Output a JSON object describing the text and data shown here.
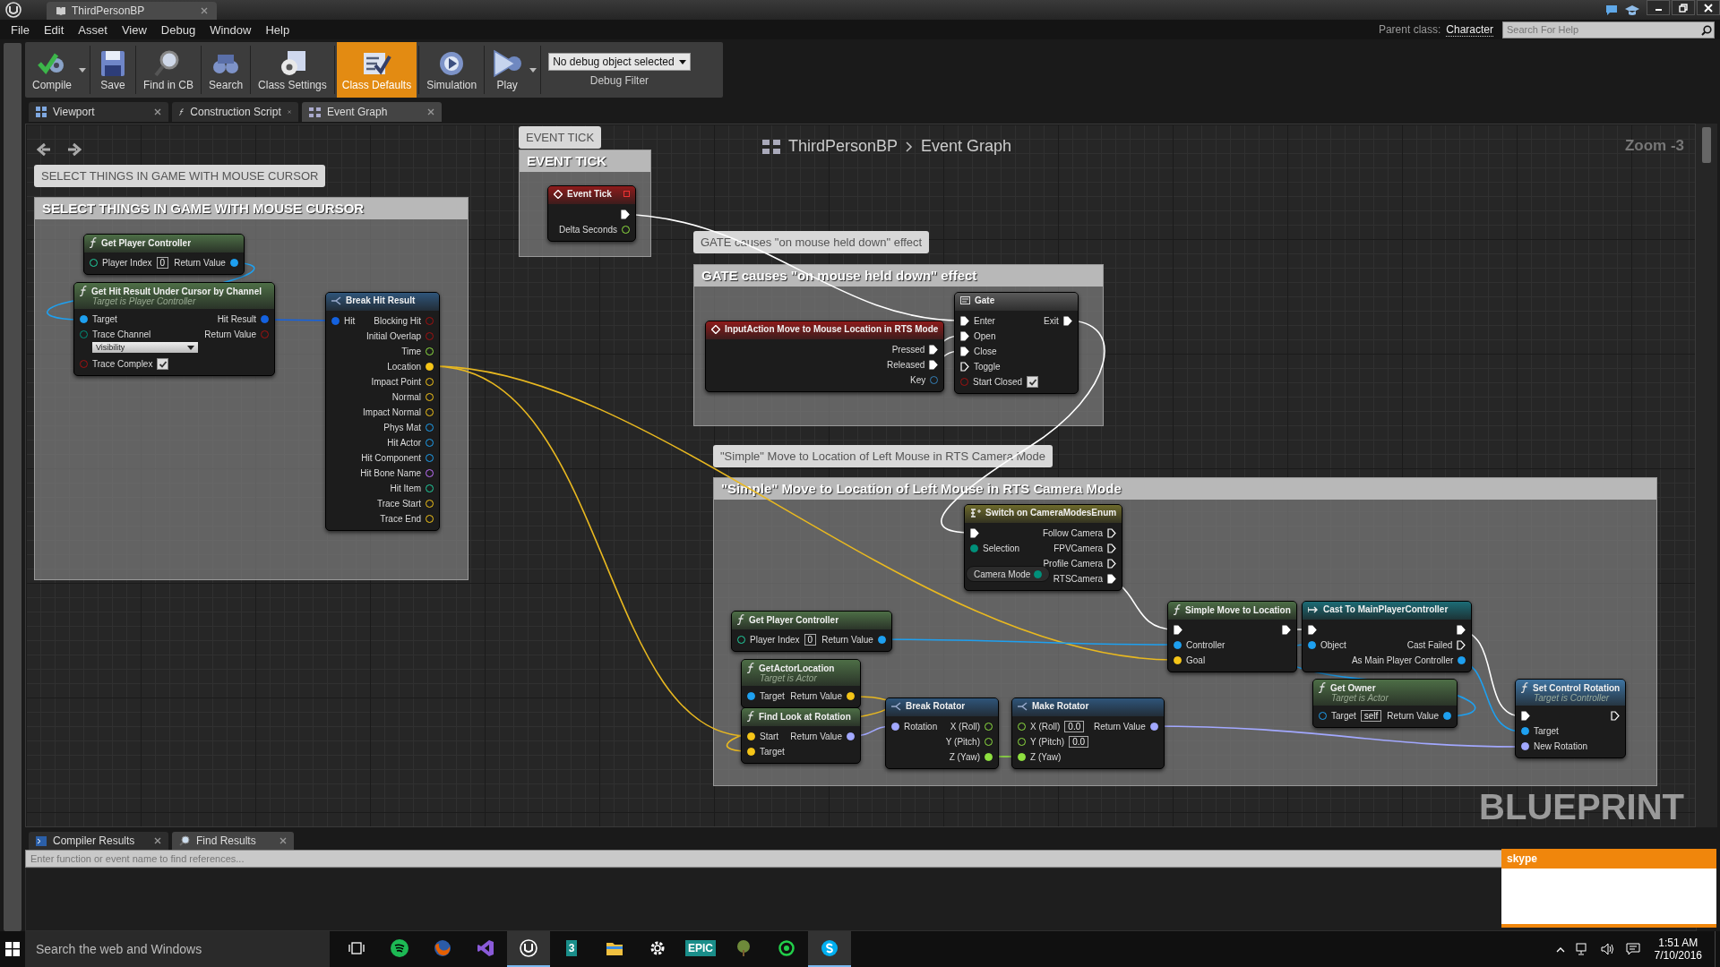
{
  "document_tab": {
    "title": "ThirdPersonBP"
  },
  "menu": [
    "File",
    "Edit",
    "Asset",
    "View",
    "Debug",
    "Window",
    "Help"
  ],
  "parent_class": {
    "label": "Parent class:",
    "value": "Character"
  },
  "help_search": {
    "placeholder": "Search For Help"
  },
  "toolbar": [
    {
      "label": "Compile",
      "kind": "compile",
      "selected": false,
      "has_menu": true
    },
    {
      "label": "Save",
      "kind": "save",
      "selected": false,
      "has_menu": false
    },
    {
      "label": "Find in CB",
      "kind": "find",
      "selected": false,
      "has_menu": false
    },
    {
      "label": "Search",
      "kind": "search",
      "selected": false,
      "has_menu": false
    },
    {
      "label": "Class Settings",
      "kind": "settings",
      "selected": false,
      "has_menu": false
    },
    {
      "label": "Class Defaults",
      "kind": "defaults",
      "selected": true,
      "has_menu": false
    },
    {
      "label": "Simulation",
      "kind": "simulation",
      "selected": false,
      "has_menu": false
    },
    {
      "label": "Play",
      "kind": "play",
      "selected": false,
      "has_menu": true
    }
  ],
  "debug_filter": {
    "value": "No debug object selected",
    "label": "Debug Filter"
  },
  "editor_tabs": [
    {
      "label": "Viewport",
      "kind": "viewport",
      "selected": false
    },
    {
      "label": "Construction Script",
      "kind": "function",
      "selected": false
    },
    {
      "label": "Event Graph",
      "kind": "graph",
      "selected": true
    }
  ],
  "graph": {
    "breadcrumb": [
      "ThirdPersonBP",
      "Event Graph"
    ],
    "zoom": "Zoom -3",
    "watermark": "BLUEPRINT",
    "comments": [
      {
        "bubble": "SELECT THINGS IN GAME WITH MOUSE CURSOR",
        "title": "SELECT THINGS IN GAME WITH MOUSE CURSOR"
      },
      {
        "bubble": "EVENT TICK",
        "title": "EVENT TICK"
      },
      {
        "bubble": "GATE causes \"on mouse held down\" effect",
        "title": "GATE causes \"on mouse held down\" effect"
      },
      {
        "bubble": "\"Simple\" Move to Location of Left Mouse in RTS Camera Mode",
        "title": "\"Simple\" Move to Location of Left Mouse in RTS Camera Mode"
      }
    ],
    "nodes": [
      {
        "kind": "function",
        "title": "Get Player Controller",
        "inputs": [
          {
            "label": "Player Index",
            "kind": "int",
            "connected": false,
            "value": "0"
          }
        ],
        "outputs": [
          {
            "label": "Return Value",
            "kind": "object",
            "connected": true
          }
        ]
      },
      {
        "kind": "function",
        "title": "Get Hit Result Under Cursor by Channel",
        "subtitle": "Target is Player Controller",
        "inputs": [
          {
            "label": "Target",
            "kind": "object",
            "connected": true
          },
          {
            "label": "Trace Channel",
            "kind": "byte",
            "connected": false,
            "dropdown": "Visibility"
          },
          {
            "label": "Trace Complex",
            "kind": "bool",
            "connected": false,
            "checked": true
          }
        ],
        "outputs": [
          {
            "label": "Hit Result",
            "kind": "struct",
            "connected": true
          },
          {
            "label": "Return Value",
            "kind": "bool",
            "connected": false
          }
        ]
      },
      {
        "kind": "struct",
        "title": "Break Hit Result",
        "inputs": [
          {
            "label": "Hit",
            "kind": "struct",
            "connected": true
          }
        ],
        "outputs": [
          {
            "label": "Blocking Hit",
            "kind": "bool",
            "connected": false
          },
          {
            "label": "Initial Overlap",
            "kind": "bool",
            "connected": false
          },
          {
            "label": "Time",
            "kind": "float",
            "connected": false
          },
          {
            "label": "Location",
            "kind": "vector",
            "connected": true
          },
          {
            "label": "Impact Point",
            "kind": "vector",
            "connected": false
          },
          {
            "label": "Normal",
            "kind": "vector",
            "connected": false
          },
          {
            "label": "Impact Normal",
            "kind": "vector",
            "connected": false
          },
          {
            "label": "Phys Mat",
            "kind": "object",
            "connected": false
          },
          {
            "label": "Hit Actor",
            "kind": "object",
            "connected": false
          },
          {
            "label": "Hit Component",
            "kind": "object",
            "connected": false
          },
          {
            "label": "Hit Bone Name",
            "kind": "name",
            "connected": false
          },
          {
            "label": "Hit Item",
            "kind": "int",
            "connected": false
          },
          {
            "label": "Trace Start",
            "kind": "vector",
            "connected": false
          },
          {
            "label": "Trace End",
            "kind": "vector",
            "connected": false
          }
        ]
      },
      {
        "kind": "event",
        "title": "Event Tick",
        "delegate": true,
        "outputs": [
          {
            "kind": "exec",
            "connected": true
          },
          {
            "label": "Delta Seconds",
            "kind": "float",
            "connected": false
          }
        ]
      },
      {
        "kind": "event",
        "title": "InputAction Move to Mouse Location in RTS Mode",
        "outputs": [
          {
            "label": "Pressed",
            "kind": "exec",
            "connected": true
          },
          {
            "label": "Released",
            "kind": "exec",
            "connected": true
          },
          {
            "label": "Key",
            "kind": "key",
            "connected": false
          }
        ]
      },
      {
        "kind": "macro",
        "title": "Gate",
        "inputs": [
          {
            "label": "Enter",
            "kind": "exec",
            "connected": true
          },
          {
            "label": "Open",
            "kind": "exec",
            "connected": true
          },
          {
            "label": "Close",
            "kind": "exec",
            "connected": true
          },
          {
            "label": "Toggle",
            "kind": "exec",
            "connected": false
          },
          {
            "label": "Start Closed",
            "kind": "bool",
            "connected": false,
            "checked": true
          }
        ],
        "outputs": [
          {
            "label": "Exit",
            "kind": "exec",
            "connected": true
          }
        ]
      },
      {
        "kind": "switch",
        "title": "Switch on CameraModesEnum",
        "inputs": [
          {
            "kind": "exec",
            "connected": true
          },
          {
            "label": "Selection",
            "kind": "byte",
            "connected": true
          }
        ],
        "outputs": [
          {
            "label": "Follow Camera",
            "kind": "exec",
            "connected": false
          },
          {
            "label": "FPVCamera",
            "kind": "exec",
            "connected": false
          },
          {
            "label": "Profile Camera",
            "kind": "exec",
            "connected": false
          },
          {
            "label": "RTSCamera",
            "kind": "exec",
            "connected": true
          }
        ]
      },
      {
        "kind": "variable",
        "title": "Camera Mode",
        "outputs": [
          {
            "kind": "byte",
            "connected": true
          }
        ]
      },
      {
        "kind": "function",
        "title": "Get Player Controller",
        "inputs": [
          {
            "label": "Player Index",
            "kind": "int",
            "connected": false,
            "value": "0"
          }
        ],
        "outputs": [
          {
            "label": "Return Value",
            "kind": "object",
            "connected": true
          }
        ]
      },
      {
        "kind": "function",
        "title": "GetActorLocation",
        "subtitle": "Target is Actor",
        "inputs": [
          {
            "label": "Target",
            "kind": "object",
            "connected": true
          }
        ],
        "outputs": [
          {
            "label": "Return Value",
            "kind": "vector",
            "connected": true
          }
        ]
      },
      {
        "kind": "function",
        "title": "Find Look at Rotation",
        "inputs": [
          {
            "label": "Start",
            "kind": "vector",
            "connected": true
          },
          {
            "label": "Target",
            "kind": "vector",
            "connected": true
          }
        ],
        "outputs": [
          {
            "label": "Return Value",
            "kind": "rotator",
            "connected": true
          }
        ]
      },
      {
        "kind": "struct",
        "title": "Break Rotator",
        "inputs": [
          {
            "label": "Rotation",
            "kind": "rotator",
            "connected": true
          }
        ],
        "outputs": [
          {
            "label": "X (Roll)",
            "kind": "float",
            "connected": false
          },
          {
            "label": "Y (Pitch)",
            "kind": "float",
            "connected": false
          },
          {
            "label": "Z (Yaw)",
            "kind": "float",
            "connected": true
          }
        ]
      },
      {
        "kind": "struct",
        "title": "Make Rotator",
        "inputs": [
          {
            "label": "X (Roll)",
            "kind": "float",
            "connected": false,
            "value": "0.0"
          },
          {
            "label": "Y (Pitch)",
            "kind": "float",
            "connected": false,
            "value": "0.0"
          },
          {
            "label": "Z (Yaw)",
            "kind": "float",
            "connected": true
          }
        ],
        "outputs": [
          {
            "label": "Return Value",
            "kind": "rotator",
            "connected": true
          }
        ]
      },
      {
        "kind": "function",
        "title": "Simple Move to Location",
        "inputs": [
          {
            "kind": "exec",
            "connected": true
          },
          {
            "label": "Controller",
            "kind": "object",
            "connected": true
          },
          {
            "label": "Goal",
            "kind": "vector",
            "connected": true
          }
        ],
        "outputs": [
          {
            "kind": "exec",
            "connected": true
          }
        ]
      },
      {
        "kind": "cast",
        "title": "Cast To MainPlayerController",
        "inputs": [
          {
            "kind": "exec",
            "connected": true
          },
          {
            "label": "Object",
            "kind": "object",
            "connected": true
          }
        ],
        "outputs": [
          {
            "kind": "exec",
            "connected": true
          },
          {
            "label": "Cast Failed",
            "kind": "exec",
            "connected": false
          },
          {
            "label": "As Main Player Controller",
            "kind": "object",
            "connected": true
          }
        ]
      },
      {
        "kind": "function",
        "title": "Get Owner",
        "subtitle": "Target is Actor",
        "inputs": [
          {
            "label": "Target",
            "kind": "object",
            "connected": false,
            "value": "self"
          }
        ],
        "outputs": [
          {
            "label": "Return Value",
            "kind": "object",
            "connected": true
          }
        ]
      },
      {
        "kind": "target",
        "title": "Set Control Rotation",
        "subtitle": "Target is Controller",
        "inputs": [
          {
            "kind": "exec",
            "connected": true
          },
          {
            "label": "Target",
            "kind": "object",
            "connected": true
          },
          {
            "label": "New Rotation",
            "kind": "rotator",
            "connected": true
          }
        ],
        "outputs": [
          {
            "kind": "exec",
            "connected": false
          }
        ]
      }
    ]
  },
  "bottom_tabs": [
    {
      "label": "Compiler Results",
      "kind": "compiler",
      "selected": false
    },
    {
      "label": "Find Results",
      "kind": "find",
      "selected": true
    }
  ],
  "find": {
    "placeholder": "Enter function or event name to find references..."
  },
  "notification": {
    "title": "skype"
  },
  "taskbar": {
    "search_placeholder": "Search the web and Windows",
    "time": "1:51 AM",
    "date": "7/10/2016",
    "apps": [
      {
        "kind": "taskview",
        "active": false
      },
      {
        "kind": "spotify",
        "active": false
      },
      {
        "kind": "firefox",
        "active": false
      },
      {
        "kind": "vs",
        "active": false
      },
      {
        "kind": "unreal",
        "active": true
      },
      {
        "kind": "tile",
        "glyph": "3",
        "active": false
      },
      {
        "kind": "explorer",
        "active": false
      },
      {
        "kind": "settings",
        "active": false
      },
      {
        "kind": "tile",
        "glyph": "EPIC",
        "active": false
      },
      {
        "kind": "tree",
        "active": false
      },
      {
        "kind": "ring",
        "active": false
      },
      {
        "kind": "skype",
        "active": true
      }
    ]
  }
}
